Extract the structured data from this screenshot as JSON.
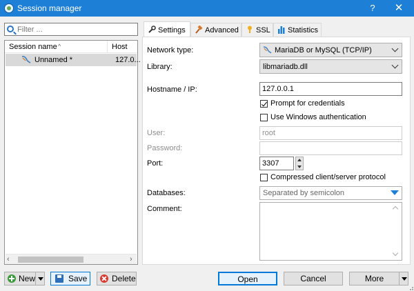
{
  "window": {
    "title": "Session manager",
    "help_label": "?",
    "close_label": "✕",
    "app_icon": "heidisql-icon"
  },
  "filter": {
    "placeholder": "Filter ..."
  },
  "session_list": {
    "columns": [
      "Session name",
      "Host"
    ],
    "sort_indicator": "^",
    "rows": [
      {
        "name": "Unnamed *",
        "host": "127.0...",
        "icon": "mariadb-icon"
      }
    ]
  },
  "left_buttons": {
    "new": "New",
    "save": "Save",
    "delete": "Delete"
  },
  "tabs": [
    {
      "label": "Settings",
      "icon": "wrench-icon",
      "active": true
    },
    {
      "label": "Advanced",
      "icon": "hammer-icon",
      "active": false
    },
    {
      "label": "SSL",
      "icon": "key-icon",
      "active": false
    },
    {
      "label": "Statistics",
      "icon": "bar-chart-icon",
      "active": false
    }
  ],
  "settings": {
    "network_type_label": "Network type:",
    "network_type_value": "MariaDB or MySQL (TCP/IP)",
    "library_label": "Library:",
    "library_value": "libmariadb.dll",
    "hostname_label": "Hostname / IP:",
    "hostname_value": "127.0.0.1",
    "prompt_credentials_label": "Prompt for credentials",
    "prompt_credentials_checked": true,
    "windows_auth_label": "Use Windows authentication",
    "windows_auth_checked": false,
    "user_label": "User:",
    "user_value": "root",
    "password_label": "Password:",
    "password_value": "",
    "port_label": "Port:",
    "port_value": "3307",
    "compressed_label": "Compressed client/server protocol",
    "compressed_checked": false,
    "databases_label": "Databases:",
    "databases_value": "Separated by semicolon",
    "comment_label": "Comment:",
    "comment_value": ""
  },
  "bottom_buttons": {
    "open": "Open",
    "cancel": "Cancel",
    "more": "More"
  },
  "colors": {
    "titlebar": "#1e7fd6",
    "accent": "#0078d7"
  }
}
